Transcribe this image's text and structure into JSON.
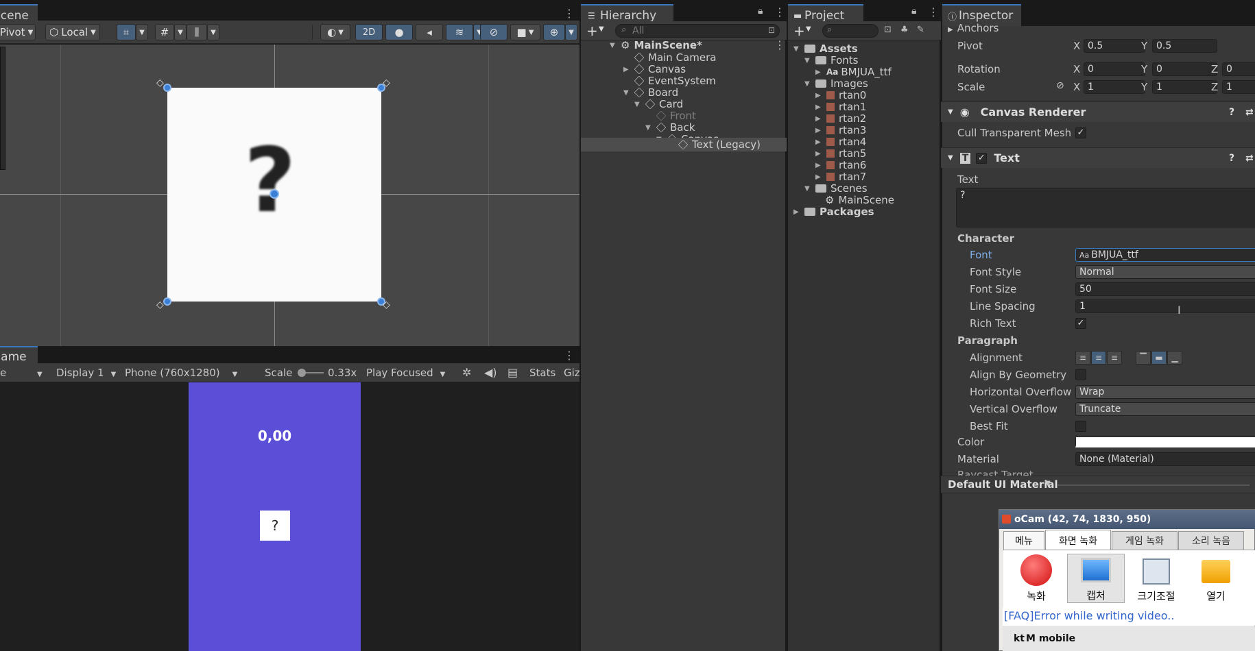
{
  "scene": {
    "tab": "Scene",
    "pivot": "Pivot",
    "local": "Local",
    "mode2d": "2D",
    "question_mark": "?"
  },
  "game": {
    "tab": "Game",
    "display": "Display 1",
    "resolution": "Phone (760x1280)",
    "scale_label": "Scale",
    "scale_value": "0.33x",
    "play_mode": "Play Focused",
    "stats": "Stats",
    "gizmos": "Giz",
    "timer": "0,00",
    "card_text": "?"
  },
  "hierarchy": {
    "tab": "Hierarchy",
    "search_placeholder": "All",
    "items": [
      {
        "label": "MainScene*"
      },
      {
        "label": "Main Camera"
      },
      {
        "label": "Canvas"
      },
      {
        "label": "EventSystem"
      },
      {
        "label": "Board"
      },
      {
        "label": "Card"
      },
      {
        "label": "Front"
      },
      {
        "label": "Back"
      },
      {
        "label": "Canvas"
      },
      {
        "label": "Text (Legacy)"
      }
    ]
  },
  "project": {
    "tab": "Project",
    "items": [
      {
        "label": "Assets"
      },
      {
        "label": "Fonts"
      },
      {
        "label": "BMJUA_ttf"
      },
      {
        "label": "Images"
      },
      {
        "label": "rtan0"
      },
      {
        "label": "rtan1"
      },
      {
        "label": "rtan2"
      },
      {
        "label": "rtan3"
      },
      {
        "label": "rtan4"
      },
      {
        "label": "rtan5"
      },
      {
        "label": "rtan6"
      },
      {
        "label": "rtan7"
      },
      {
        "label": "Scenes"
      },
      {
        "label": "MainScene"
      },
      {
        "label": "Packages"
      }
    ]
  },
  "inspector": {
    "tab": "Inspector",
    "anchors": "Anchors",
    "pivot": {
      "label": "Pivot",
      "x": "0.5",
      "y": "0.5"
    },
    "rotation": {
      "label": "Rotation",
      "x": "0",
      "y": "0",
      "z": "0"
    },
    "scale": {
      "label": "Scale",
      "x": "1",
      "y": "1",
      "z": "1"
    },
    "axis_x": "X",
    "axis_y": "Y",
    "axis_z": "Z",
    "canvas_renderer": "Canvas Renderer",
    "cull_transparent_mesh": "Cull Transparent Mesh",
    "text_component": "Text",
    "text_label": "Text",
    "text_value": "?",
    "character": "Character",
    "font": {
      "label": "Font",
      "value": "BMJUA_ttf",
      "prefix": "Aa"
    },
    "font_style": {
      "label": "Font Style",
      "value": "Normal"
    },
    "font_size": {
      "label": "Font Size",
      "value": "50"
    },
    "line_spacing": {
      "label": "Line Spacing",
      "value": "1"
    },
    "rich_text": "Rich Text",
    "paragraph": "Paragraph",
    "alignment": "Alignment",
    "align_by_geometry": "Align By Geometry",
    "horizontal_overflow": {
      "label": "Horizontal Overflow",
      "value": "Wrap"
    },
    "vertical_overflow": {
      "label": "Vertical Overflow",
      "value": "Truncate"
    },
    "best_fit": "Best Fit",
    "color": "Color",
    "material": {
      "label": "Material",
      "value": "None (Material)"
    },
    "raycast_target": "Raycast Target",
    "default_material": "Default UI Material"
  },
  "ocam": {
    "title": "oCam (42, 74, 1830, 950)",
    "tabs": [
      "메뉴",
      "화면 녹화",
      "게임 녹화",
      "소리 녹음"
    ],
    "buttons": [
      "녹화",
      "캡처",
      "크기조절",
      "열기"
    ],
    "faq": "[FAQ]Error while writing video..",
    "ad": "M mobile",
    "ad_brand": "kt"
  },
  "colors": {
    "accent": "#3a79bb",
    "game_bg": "#5b4fd8",
    "selection": "#2c5d87"
  }
}
